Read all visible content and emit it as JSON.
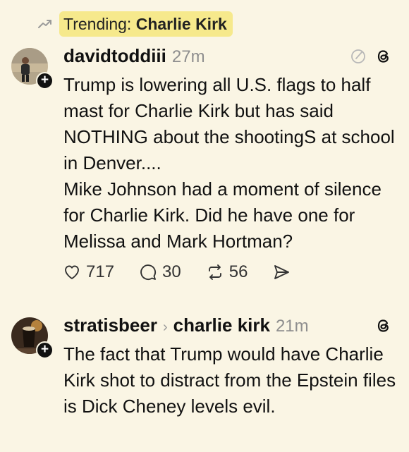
{
  "trending": {
    "prefix": "Trending:",
    "topic": "Charlie Kirk",
    "icon": "trending-arrow-icon",
    "highlight_color": "#f6e98c"
  },
  "posts": [
    {
      "username": "davidtoddiii",
      "time": "27m",
      "paragraphs": [
        "Trump is lowering all U.S. flags to half mast for Charlie Kirk but has said NOTHING about the shootingS at school in Denver....",
        "Mike Johnson had a moment of silence for Charlie Kirk.  Did he have one for Melissa and Mark Hortman?"
      ],
      "likes": "717",
      "replies": "30",
      "reposts": "56"
    },
    {
      "username": "stratisbeer",
      "topic": "charlie kirk",
      "time": "21m",
      "paragraphs": [
        "The fact that Trump would have Charlie Kirk shot to distract from the Epstein files is Dick Cheney levels evil."
      ]
    }
  ],
  "colors": {
    "background": "#faf5e4",
    "muted_text": "#8e8e8e"
  }
}
